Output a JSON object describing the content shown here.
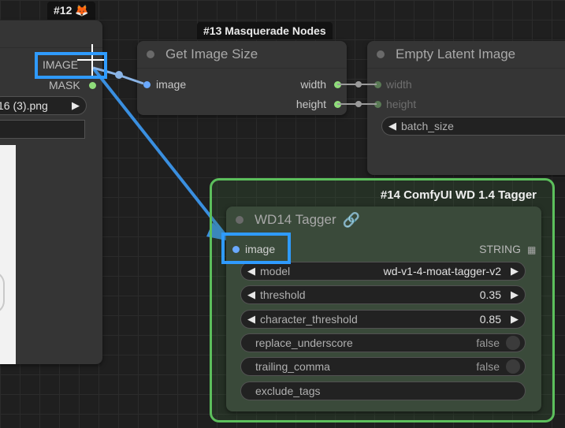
{
  "node12": {
    "badge": "#12",
    "badge_icon": "fox-icon",
    "outputs": [
      "IMAGE",
      "MASK"
    ],
    "filename": "16 (3).png"
  },
  "node13": {
    "badge": "#13 Masquerade Nodes",
    "title": "Get Image Size",
    "input": "image",
    "outputs": [
      "width",
      "height"
    ]
  },
  "empty_latent": {
    "title": "Empty Latent Image",
    "inputs": [
      "width",
      "height"
    ],
    "widget": "batch_size"
  },
  "node14": {
    "badge": "#14 ComfyUI WD 1.4 Tagger",
    "title": "WD14 Tagger",
    "title_icon": "link-icon",
    "input": "image",
    "output": "STRING",
    "widgets": [
      {
        "label": "model",
        "value": "wd-v1-4-moat-tagger-v2"
      },
      {
        "label": "threshold",
        "value": "0.35"
      },
      {
        "label": "character_threshold",
        "value": "0.85"
      },
      {
        "label": "replace_underscore",
        "value": "false"
      },
      {
        "label": "trailing_comma",
        "value": "false"
      },
      {
        "label": "exclude_tags",
        "value": ""
      }
    ]
  },
  "colors": {
    "image_slot": "#6aa9ff",
    "int_slot": "#8fdc7a",
    "highlight": "#2f9bff",
    "group_border": "#5cbf5c",
    "link": "#3a8fe0"
  }
}
